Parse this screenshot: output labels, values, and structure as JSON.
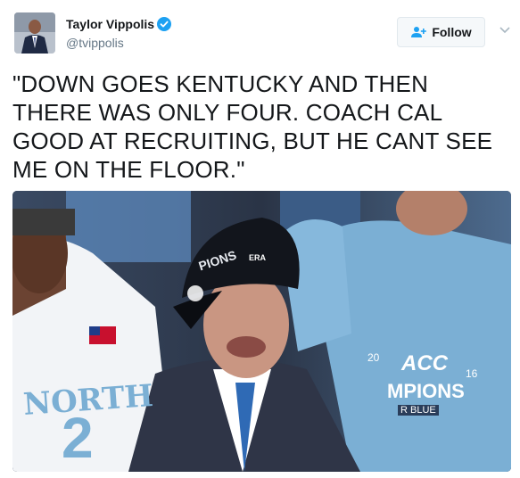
{
  "user": {
    "name": "Taylor Vippolis",
    "handle": "@tvippolis"
  },
  "follow_button": {
    "label": "Follow"
  },
  "tweet": {
    "text": "\"DOWN GOES KENTUCKY AND THEN THERE WAS ONLY FOUR. COACH CAL GOOD AT RECRUITING, BUT HE CANT SEE ME ON THE FLOOR.\""
  },
  "photo": {
    "jersey_text": "NORTH",
    "jersey_number": "2",
    "shirt_acc": "ACC",
    "shirt_champions": "MPIONS",
    "shirt_blue": "R BLUE",
    "shirt_year_left": "20",
    "shirt_year_right": "16",
    "hat_text": "PIONS",
    "hat_brand": "ERA"
  },
  "colors": {
    "verified": "#1da1f2",
    "follow_icon": "#1da1f2",
    "unc_blue": "#7bafd4"
  },
  "icons": {
    "verified": "verified-badge-icon",
    "follow": "add-person-icon",
    "caret": "chevron-down-icon"
  }
}
